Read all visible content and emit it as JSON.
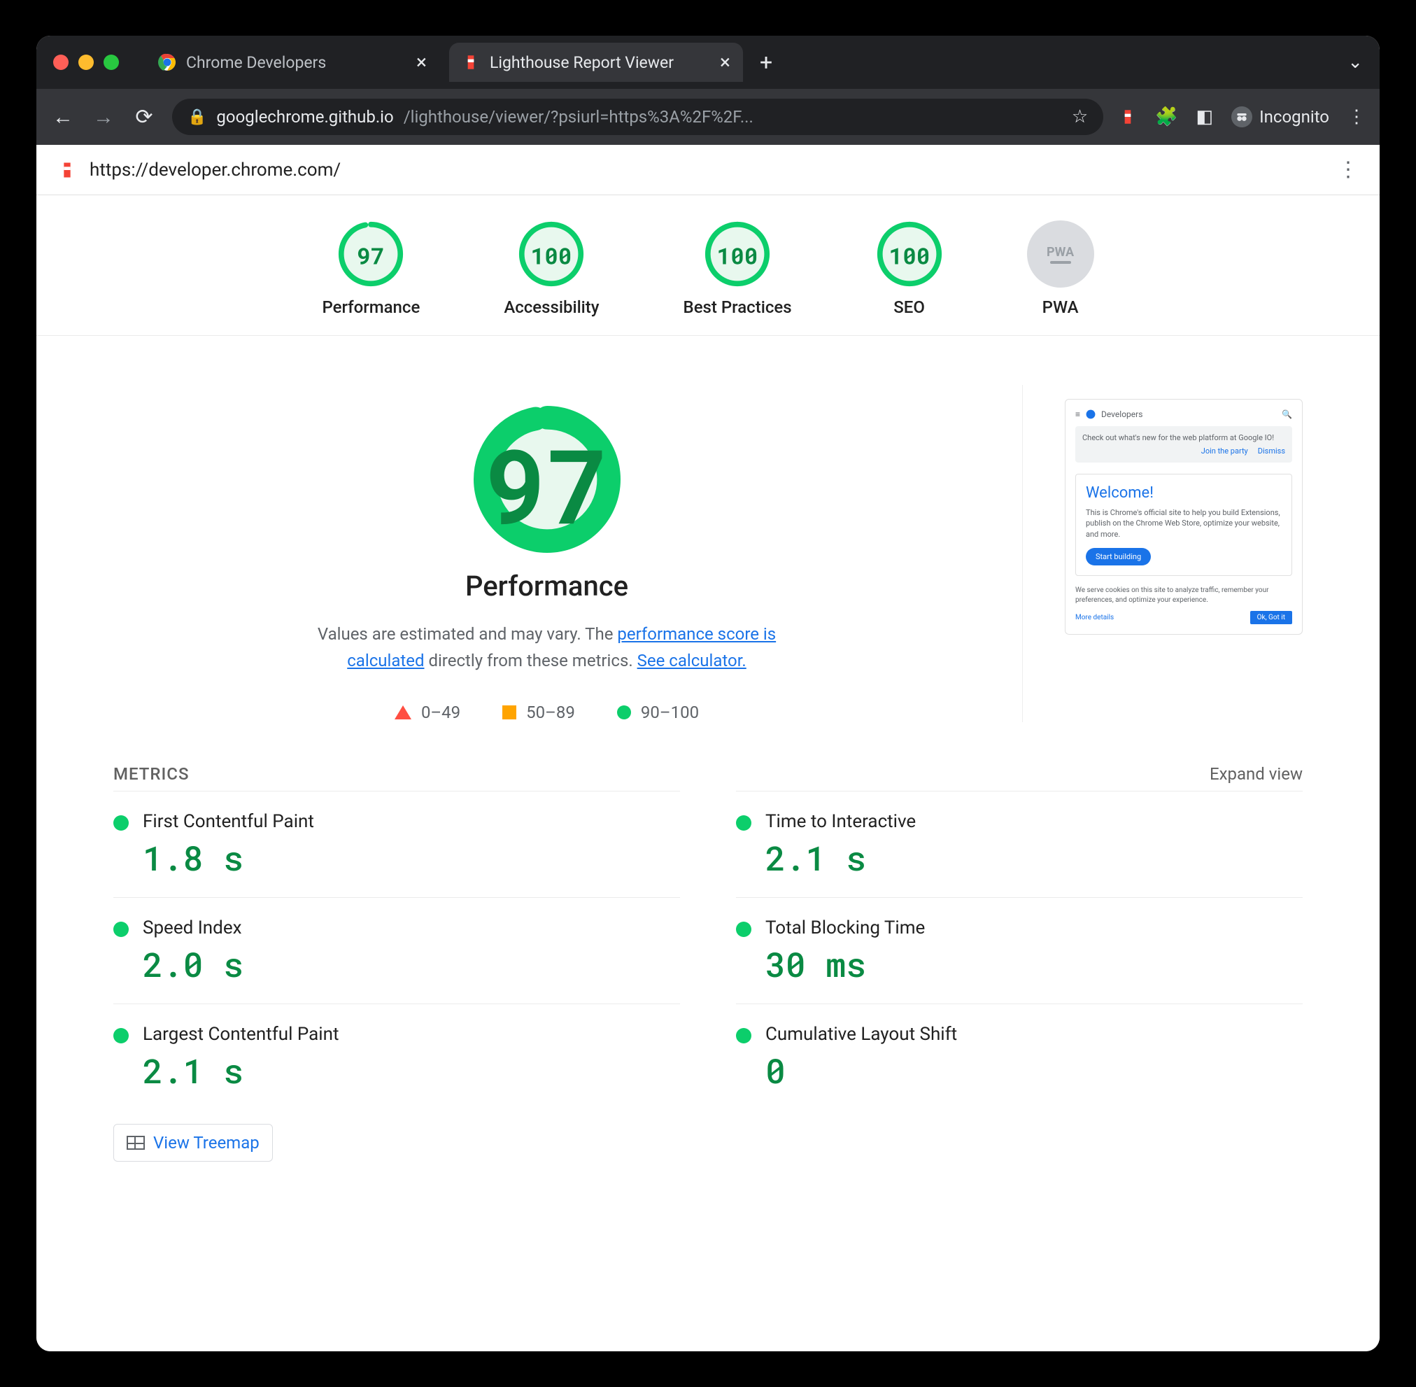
{
  "browser": {
    "tabs": [
      {
        "title": "Chrome Developers",
        "active": false
      },
      {
        "title": "Lighthouse Report Viewer",
        "active": true
      }
    ],
    "url_host": "googlechrome.github.io",
    "url_rest": "/lighthouse/viewer/?psiurl=https%3A%2F%2F...",
    "incognito_label": "Incognito"
  },
  "topbar": {
    "tested_url": "https://developer.chrome.com/"
  },
  "gauges": {
    "performance": {
      "label": "Performance",
      "score": "97",
      "pct": 97
    },
    "accessibility": {
      "label": "Accessibility",
      "score": "100",
      "pct": 100
    },
    "best_practices": {
      "label": "Best Practices",
      "score": "100",
      "pct": 100
    },
    "seo": {
      "label": "SEO",
      "score": "100",
      "pct": 100
    },
    "pwa": {
      "label": "PWA",
      "badge": "PWA"
    }
  },
  "perf_section": {
    "score": "97",
    "pct": 97,
    "title": "Performance",
    "desc_pre": "Values are estimated and may vary. The ",
    "link1": "performance score is calculated",
    "desc_mid": " directly from these metrics. ",
    "link2": "See calculator.",
    "legend": {
      "fail": "0–49",
      "avg": "50–89",
      "pass": "90–100"
    }
  },
  "thumbnail": {
    "brand": "Developers",
    "banner_text": "Check out what's new for the web platform at Google IO!",
    "banner_link1": "Join the party",
    "banner_link2": "Dismiss",
    "welcome_title": "Welcome!",
    "welcome_body": "This is Chrome's official site to help you build Extensions, publish on the Chrome Web Store, optimize your website, and more.",
    "welcome_cta": "Start building",
    "cookie_text": "We serve cookies on this site to analyze traffic, remember your preferences, and optimize your experience.",
    "cookie_more": "More details",
    "cookie_ok": "Ok, Got it"
  },
  "metrics": {
    "header": "METRICS",
    "expand": "Expand view",
    "items": [
      {
        "name": "First Contentful Paint",
        "value": "1.8 s"
      },
      {
        "name": "Time to Interactive",
        "value": "2.1 s"
      },
      {
        "name": "Speed Index",
        "value": "2.0 s"
      },
      {
        "name": "Total Blocking Time",
        "value": "30 ms"
      },
      {
        "name": "Largest Contentful Paint",
        "value": "2.1 s"
      },
      {
        "name": "Cumulative Layout Shift",
        "value": "0"
      }
    ],
    "treemap": "View Treemap"
  }
}
